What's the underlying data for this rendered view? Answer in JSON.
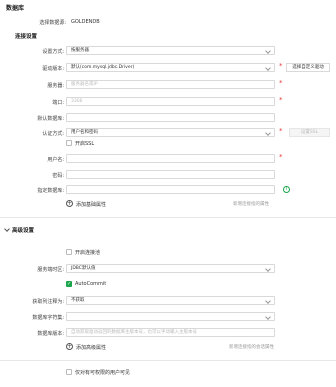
{
  "page_title": "数据库",
  "selected_db": {
    "label": "选择数据源:",
    "value": "GOLDENDB"
  },
  "connection_section": "连接设置",
  "fields": {
    "setup_mode": {
      "label": "设置方式:",
      "value": "按服务器"
    },
    "driver": {
      "label": "驱动版本:",
      "value": "默认(com.mysql.jdbc.Driver)",
      "button": "选择自定义驱动"
    },
    "server": {
      "label": "服务器:",
      "placeholder": "服务器名或IP"
    },
    "port": {
      "label": "端口:",
      "placeholder": "3306"
    },
    "default_db": {
      "label": "默认数据库:"
    },
    "auth": {
      "label": "认证方式:",
      "value": "用户名和密码",
      "button": "设置SSL"
    },
    "ssl": {
      "label": "开启SSL"
    },
    "username": {
      "label": "用户名:"
    },
    "password": {
      "label": "密码:"
    },
    "specified_db": {
      "label": "指定数据库:"
    }
  },
  "add_basic": {
    "label": "添加基础属性",
    "hint": "新增连接指的属性"
  },
  "advanced_section": "高级设置",
  "advanced": {
    "enable_pool": {
      "label": "开启连接池"
    },
    "timezone": {
      "label": "服务端时区:",
      "value": "JDBC默认值"
    },
    "autocommit": {
      "label": "AutoCommit"
    },
    "fetch_remarks": {
      "label": "获取列注释为:",
      "value": "不获取"
    },
    "charset": {
      "label": "数据库字符集:"
    },
    "db_version": {
      "label": "数据库版本:",
      "placeholder": "自动获取驱动返回的数据库主版本号，也可以手动输入主版本号"
    }
  },
  "add_advanced": {
    "label": "添加高级属性",
    "hint": "新增连接指的会话属性"
  },
  "only_permitted": {
    "label": "仅对有可权限的用户可见"
  }
}
